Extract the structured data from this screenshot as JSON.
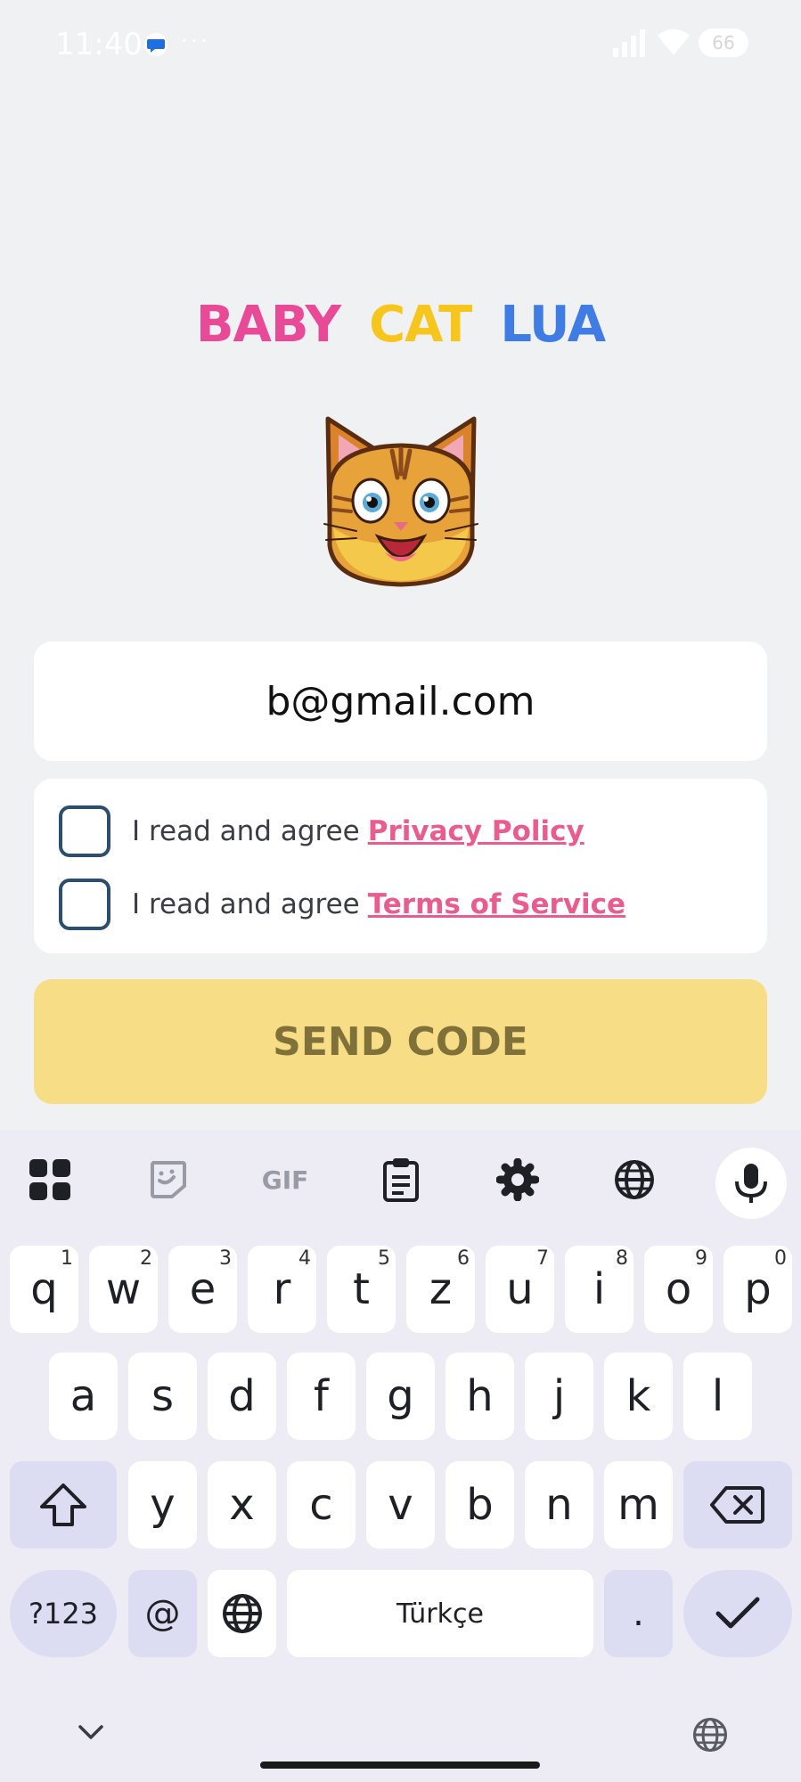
{
  "status_bar": {
    "time": "11:40",
    "battery": "66",
    "icons": [
      "message-icon",
      "more-dots-icon",
      "signal-icon",
      "wifi-icon",
      "battery-icon"
    ]
  },
  "app": {
    "title_parts": [
      "BABY",
      "CAT",
      "LUA"
    ],
    "colors": {
      "baby": "#e84a97",
      "cat": "#f6c61c",
      "lua": "#3f7de5"
    },
    "logo": "cat-face-icon"
  },
  "email": {
    "value": "b@gmail.com"
  },
  "agreements": [
    {
      "prefix": "I read and agree",
      "link": "Privacy Policy",
      "checked": false
    },
    {
      "prefix": "I read and agree",
      "link": "Terms of Service",
      "checked": false
    }
  ],
  "send_button": {
    "label": "SEND CODE",
    "color": "#f7de86"
  },
  "keyboard": {
    "toolbar": [
      "apps-grid-icon",
      "sticker-icon",
      "gif-icon",
      "clipboard-icon",
      "gear-icon",
      "globe-icon",
      "mic-icon"
    ],
    "gif_label": "GIF",
    "row1": [
      {
        "key": "q",
        "hint": "1"
      },
      {
        "key": "w",
        "hint": "2"
      },
      {
        "key": "e",
        "hint": "3"
      },
      {
        "key": "r",
        "hint": "4"
      },
      {
        "key": "t",
        "hint": "5"
      },
      {
        "key": "z",
        "hint": "6"
      },
      {
        "key": "u",
        "hint": "7"
      },
      {
        "key": "i",
        "hint": "8"
      },
      {
        "key": "o",
        "hint": "9"
      },
      {
        "key": "p",
        "hint": "0"
      }
    ],
    "row2": [
      "a",
      "s",
      "d",
      "f",
      "g",
      "h",
      "j",
      "k",
      "l"
    ],
    "row3": [
      "y",
      "x",
      "c",
      "v",
      "b",
      "n",
      "m"
    ],
    "symbols_label": "?123",
    "at_label": "@",
    "space_label": "Türkçe",
    "period_label": ".",
    "accent": "#dcdcf3"
  }
}
